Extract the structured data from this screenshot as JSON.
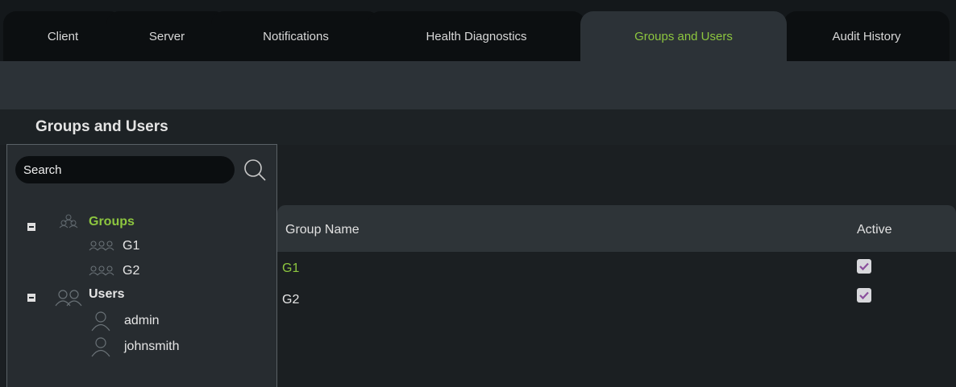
{
  "tabs": [
    {
      "label": "Client"
    },
    {
      "label": "Server"
    },
    {
      "label": "Notifications"
    },
    {
      "label": "Health Diagnostics"
    },
    {
      "label": "Groups and Users",
      "active": true
    },
    {
      "label": "Audit History"
    }
  ],
  "section": {
    "title": "Groups and Users"
  },
  "search": {
    "value": "Search"
  },
  "tree": {
    "groups": {
      "label": "Groups",
      "children": [
        "G1",
        "G2"
      ]
    },
    "users": {
      "label": "Users",
      "children": [
        "admin",
        "johnsmith"
      ]
    }
  },
  "table": {
    "columns": [
      "Group Name",
      "Active"
    ],
    "rows": [
      {
        "name": "G1",
        "active": true,
        "selected": true
      },
      {
        "name": "G2",
        "active": true,
        "selected": false
      }
    ]
  },
  "colors": {
    "accent": "#8dc63f",
    "check_mark": "#8a4f9c"
  },
  "icons": [
    "search-icon",
    "group-icon",
    "user-icon",
    "checkbox-checked-icon",
    "collapse-icon"
  ]
}
